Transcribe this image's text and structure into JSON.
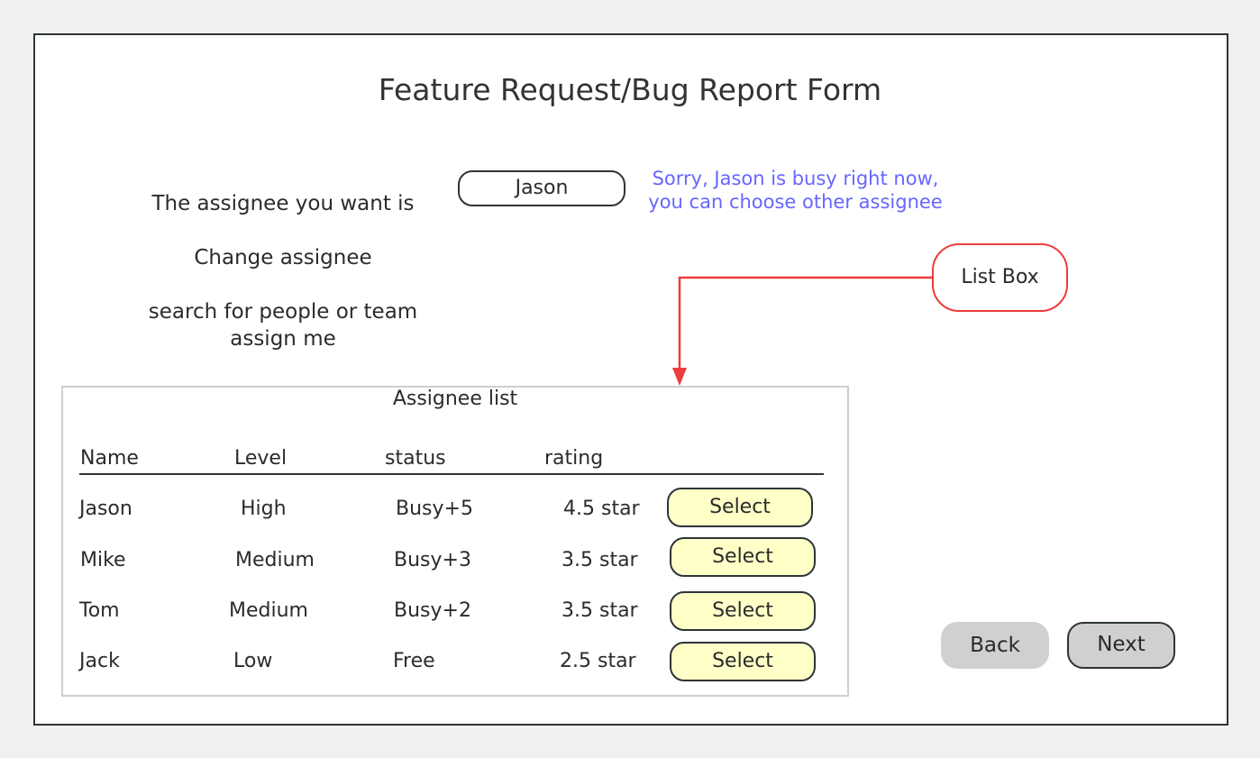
{
  "form": {
    "title": "Feature Request/Bug Report Form",
    "assignee_label": "The assignee you want is",
    "assignee_value": "Jason",
    "busy_note_line1": "Sorry, Jason is busy right now,",
    "busy_note_line2": "you can choose other assignee",
    "change_assignee": "Change assignee",
    "search_people": "search for people or team",
    "assign_me": "assign me"
  },
  "callout": {
    "label": "List Box",
    "color": "#ee3b3b"
  },
  "assignee_list": {
    "title": "Assignee list",
    "columns": [
      "Name",
      "Level",
      "status",
      "rating"
    ],
    "rows": [
      {
        "name": "Jason",
        "level": "High",
        "status": "Busy+5",
        "rating": "4.5 star",
        "action": "Select"
      },
      {
        "name": "Mike",
        "level": "Medium",
        "status": "Busy+3",
        "rating": "3.5 star",
        "action": "Select"
      },
      {
        "name": "Tom",
        "level": "Medium",
        "status": "Busy+2",
        "rating": "3.5 star",
        "action": "Select"
      },
      {
        "name": "Jack",
        "level": "Low",
        "status": "Free",
        "rating": "2.5 star",
        "action": "Select"
      }
    ]
  },
  "nav": {
    "back_label": "Back",
    "next_label": "Next"
  },
  "colors": {
    "note": "#6666ff",
    "select_fill": "#ffffc8",
    "nav_fill": "#d0d0d0"
  }
}
